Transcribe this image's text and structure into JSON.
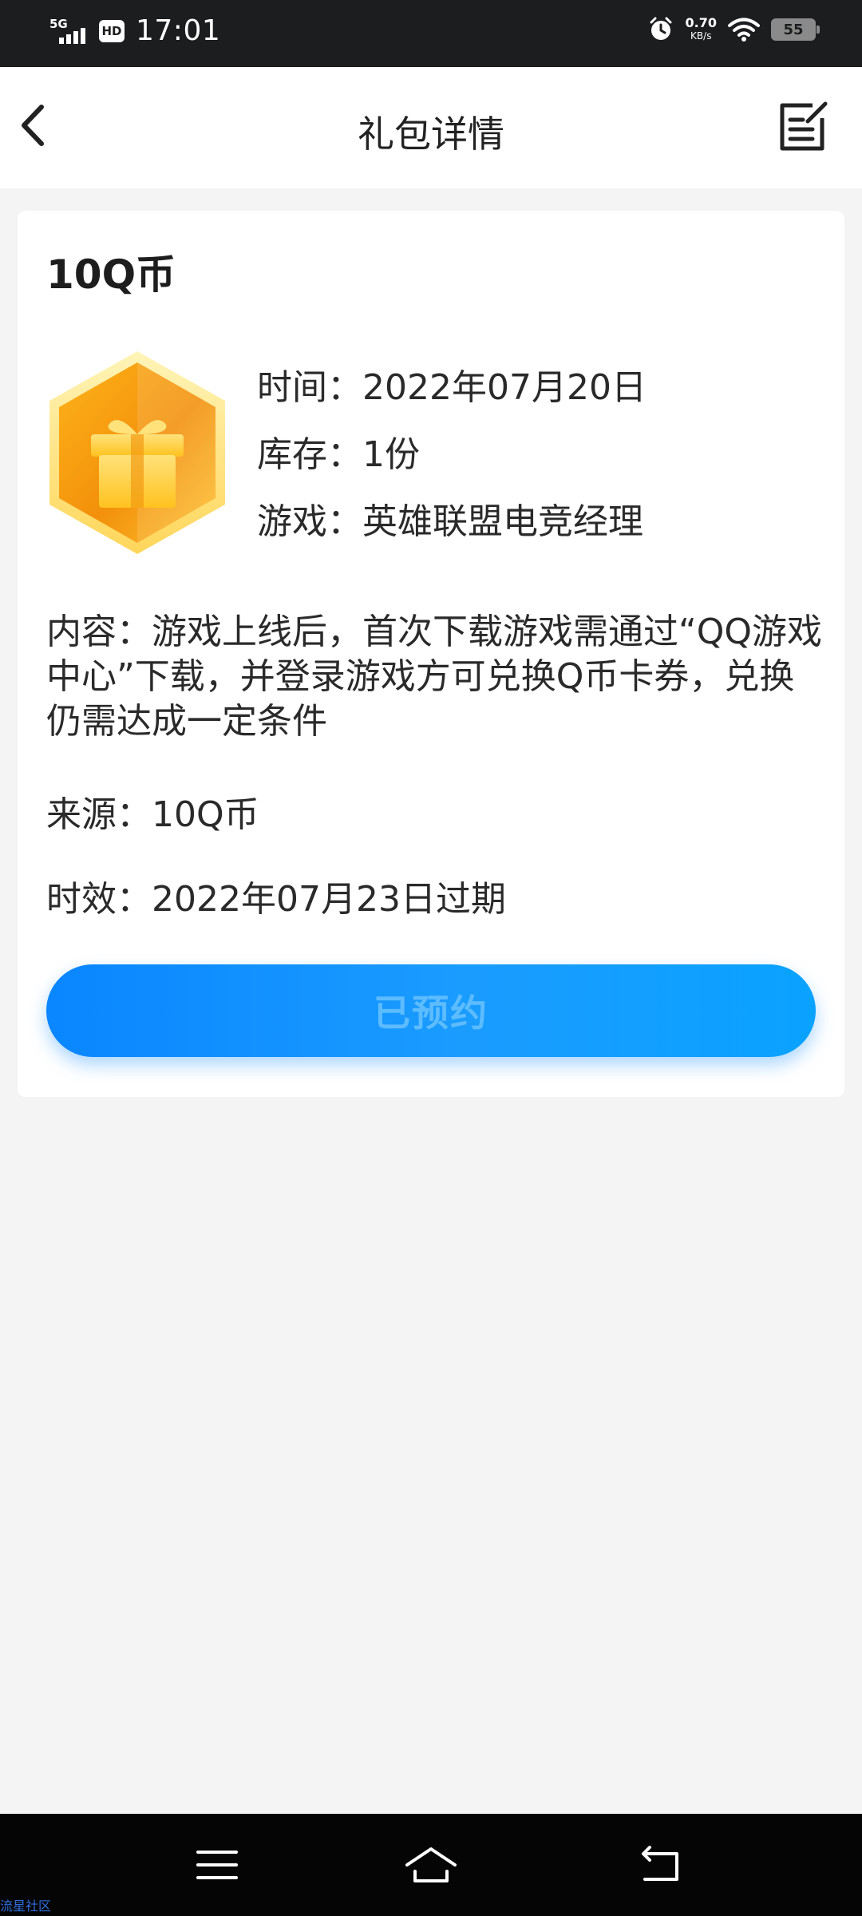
{
  "status_bar": {
    "network": "5G",
    "hd": "HD",
    "time": "17:01",
    "speed_value": "0.70",
    "speed_unit": "KB/s",
    "battery": "55",
    "icons": [
      "signal-icon",
      "alarm-icon",
      "wifi-icon",
      "battery-icon"
    ]
  },
  "header": {
    "title": "礼包详情",
    "back_icon": "chevron-left-icon",
    "edit_icon": "edit-note-icon"
  },
  "gift": {
    "name": "10Q币",
    "icon": "gift-box-icon",
    "info": [
      {
        "label": "时间：",
        "value": "2022年07月20日"
      },
      {
        "label": "库存：",
        "value": "1份"
      },
      {
        "label": "游戏：",
        "value": "英雄联盟电竞经理"
      }
    ],
    "content_label": "内容：",
    "content_text": "游戏上线后，首次下载游戏需通过“QQ游戏中心”下载，并登录游戏方可兑换Q币卡券，兑换仍需达成一定条件",
    "source_label": "来源：",
    "source_value": "10Q币",
    "expire_label": "时效：",
    "expire_value": "2022年07月23日过期",
    "button_label": "已预约"
  },
  "system_nav": {
    "icons": [
      "menu-icon",
      "home-icon",
      "back-icon"
    ]
  },
  "watermark": "流星社区",
  "colors": {
    "accent": "#1a9cff",
    "button_text": "#5dbcff",
    "background": "#f4f4f5"
  }
}
